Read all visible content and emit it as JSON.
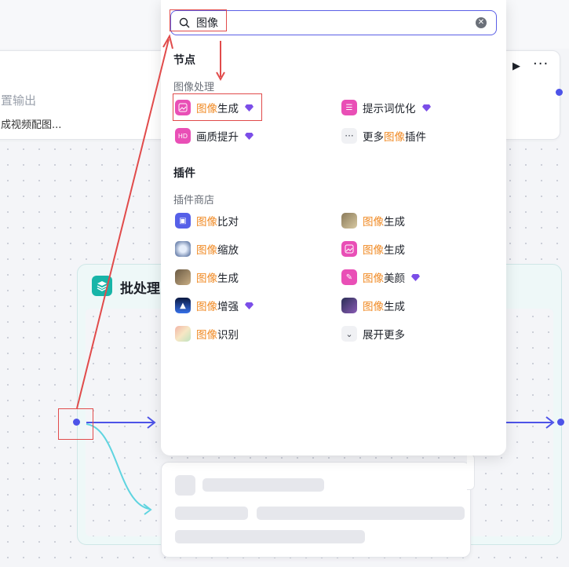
{
  "canvas": {
    "left_node": {
      "line1": "置输出",
      "line2": "成视频配图..."
    },
    "batch_node": {
      "title": "批处理"
    }
  },
  "popup": {
    "search": {
      "value": "图像",
      "placeholder": ""
    },
    "sections": {
      "nodes_title": "节点",
      "image_processing_title": "图像处理",
      "plugins_title": "插件",
      "plugin_store_title": "插件商店"
    },
    "highlight_term": "图像",
    "image_processing_items": [
      {
        "hl": "图像",
        "rest": "生成",
        "pre": "",
        "icon": "image-gen-icon",
        "premium": true
      },
      {
        "hl": "",
        "rest": "提示词优化",
        "pre": "",
        "icon": "prompt-optimize-icon",
        "premium": true
      },
      {
        "hl": "",
        "rest": "画质提升",
        "pre": "",
        "icon": "quality-upscale-icon",
        "premium": true
      },
      {
        "hl": "图像",
        "rest": "插件",
        "pre": "更多",
        "icon": "more-dots-icon",
        "premium": false
      }
    ],
    "plugin_store_items": [
      {
        "hl": "图像",
        "rest": "比对",
        "icon": "cube-icon",
        "premium": false
      },
      {
        "hl": "图像",
        "rest": "生成",
        "icon": "cat-photo-icon",
        "premium": false
      },
      {
        "hl": "图像",
        "rest": "缩放",
        "icon": "zoom-lens-icon",
        "premium": false
      },
      {
        "hl": "图像",
        "rest": "生成",
        "icon": "image-gen-icon",
        "premium": false
      },
      {
        "hl": "图像",
        "rest": "生成",
        "icon": "group-photo-icon",
        "premium": false
      },
      {
        "hl": "图像",
        "rest": "美颜",
        "icon": "beauty-brush-icon",
        "premium": true
      },
      {
        "hl": "图像",
        "rest": "增强",
        "icon": "enhance-light-icon",
        "premium": true
      },
      {
        "hl": "图像",
        "rest": "生成",
        "icon": "anime-art-icon",
        "premium": false
      },
      {
        "hl": "图像",
        "rest": "识别",
        "icon": "recognize-collage-icon",
        "premium": false
      }
    ],
    "expand_more": "展开更多"
  },
  "colors": {
    "accent": "#4d53e8",
    "highlight": "#f08a24",
    "premium_gem": "#7b4ee8",
    "annotation": "#e14b4b",
    "batch_teal": "#17b5a8",
    "connector_cyan": "#5fd4e0"
  }
}
